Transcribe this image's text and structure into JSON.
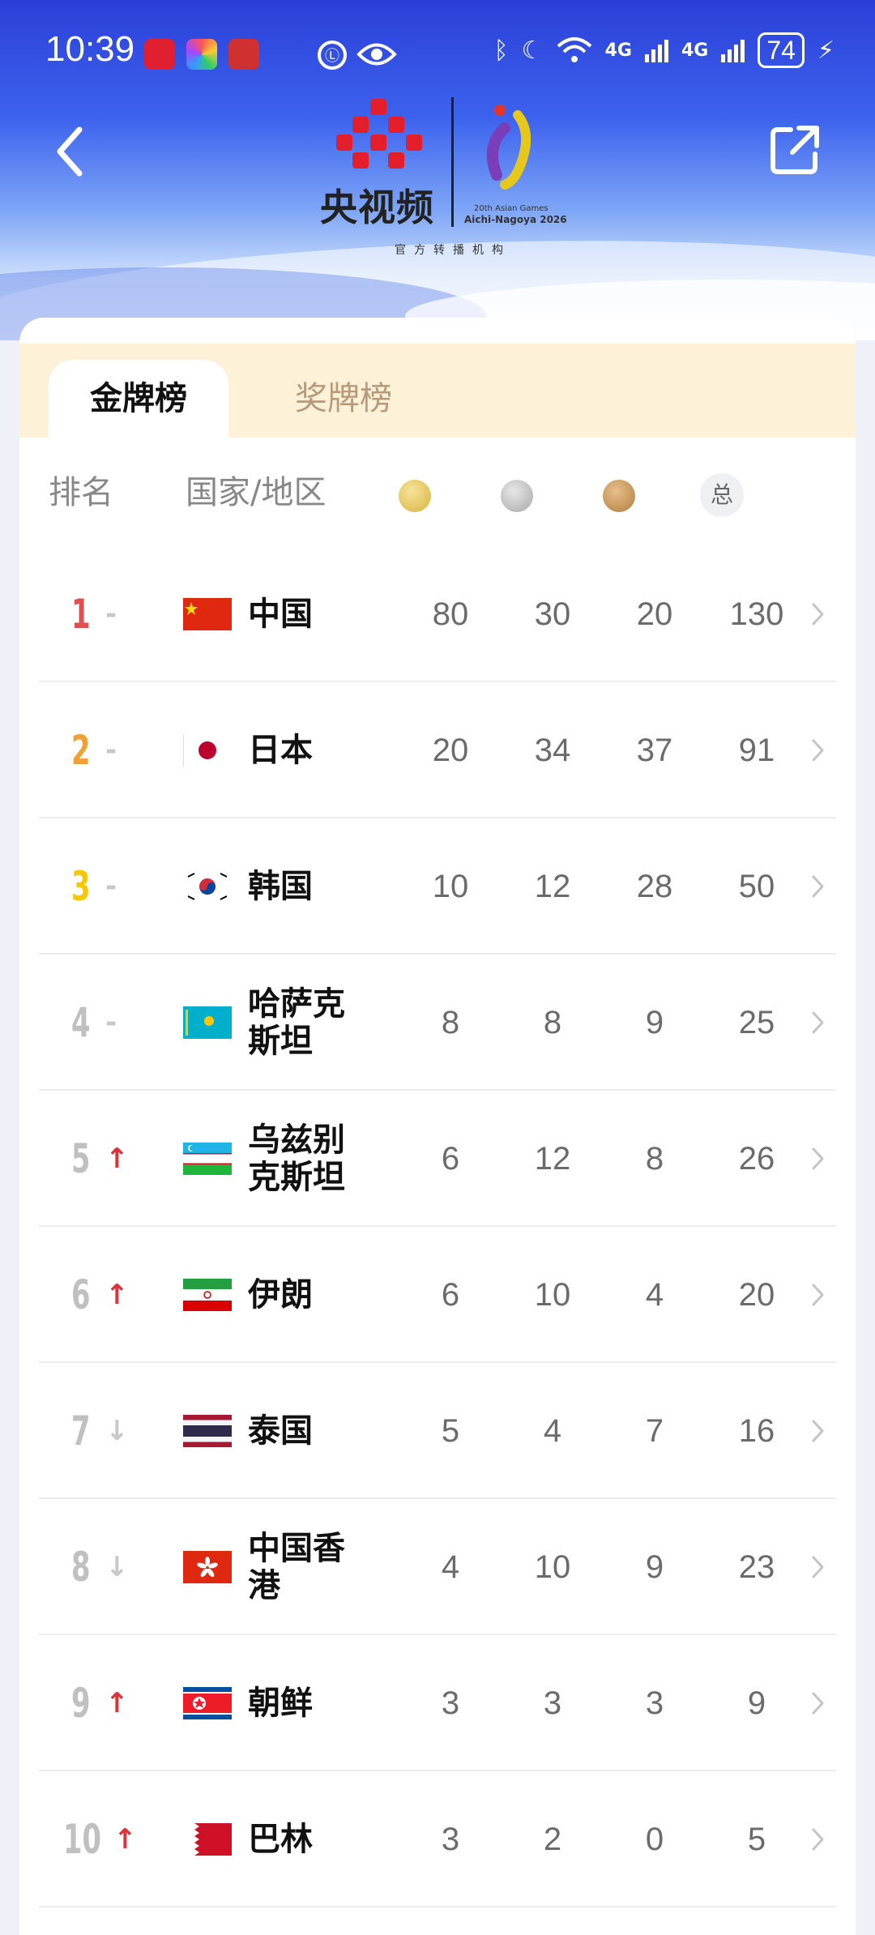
{
  "status_bar": {
    "time": "10:39",
    "battery": "74",
    "network": "4G"
  },
  "logo": {
    "brand": "央视频",
    "subtitle": "官方转播机构",
    "games_line1": "20th Asian Games",
    "games_line2": "Aichi-Nagoya 2026"
  },
  "tabs": [
    {
      "label": "金牌榜",
      "active": true
    },
    {
      "label": "奖牌榜",
      "active": false
    }
  ],
  "table": {
    "header": {
      "rank": "排名",
      "country": "国家/地区",
      "total": "总"
    },
    "rows": [
      {
        "rank": "1",
        "rank_color": "#e05050",
        "trend": "-",
        "trend_icon": "dash",
        "country": "中国",
        "flag": "china-flag",
        "gold": "80",
        "silver": "30",
        "bronze": "20",
        "total": "130"
      },
      {
        "rank": "2",
        "rank_color": "#f2a030",
        "trend": "-",
        "trend_icon": "dash",
        "country": "日本",
        "flag": "japan-flag",
        "gold": "20",
        "silver": "34",
        "bronze": "37",
        "total": "91"
      },
      {
        "rank": "3",
        "rank_color": "#f5c800",
        "trend": "-",
        "trend_icon": "dash",
        "country": "韩国",
        "flag": "korea-flag",
        "gold": "10",
        "silver": "12",
        "bronze": "28",
        "total": "50"
      },
      {
        "rank": "4",
        "rank_color": "#c0c0c0",
        "trend": "-",
        "trend_icon": "dash",
        "country": "哈萨克斯坦",
        "flag": "kazakhstan-flag",
        "gold": "8",
        "silver": "8",
        "bronze": "9",
        "total": "25"
      },
      {
        "rank": "5",
        "rank_color": "#c0c0c0",
        "trend": "↑",
        "trend_icon": "up-arrow",
        "country": "乌兹别克斯坦",
        "flag": "uzbekistan-flag",
        "gold": "6",
        "silver": "12",
        "bronze": "8",
        "total": "26"
      },
      {
        "rank": "6",
        "rank_color": "#c0c0c0",
        "trend": "↑",
        "trend_icon": "up-arrow",
        "country": "伊朗",
        "flag": "iran-flag",
        "gold": "6",
        "silver": "10",
        "bronze": "4",
        "total": "20"
      },
      {
        "rank": "7",
        "rank_color": "#c0c0c0",
        "trend": "↓",
        "trend_icon": "down-arrow",
        "country": "泰国",
        "flag": "thailand-flag",
        "gold": "5",
        "silver": "4",
        "bronze": "7",
        "total": "16"
      },
      {
        "rank": "8",
        "rank_color": "#c0c0c0",
        "trend": "↓",
        "trend_icon": "down-arrow",
        "country": "中国香港",
        "flag": "hongkong-flag",
        "gold": "4",
        "silver": "10",
        "bronze": "9",
        "total": "23"
      },
      {
        "rank": "9",
        "rank_color": "#c0c0c0",
        "trend": "↑",
        "trend_icon": "up-arrow",
        "country": "朝鲜",
        "flag": "dprk-flag",
        "gold": "3",
        "silver": "3",
        "bronze": "3",
        "total": "9"
      },
      {
        "rank": "10",
        "rank_color": "#c0c0c0",
        "trend": "↑",
        "trend_icon": "up-arrow",
        "country": "巴林",
        "flag": "bahrain-flag",
        "gold": "3",
        "silver": "2",
        "bronze": "0",
        "total": "5"
      }
    ]
  },
  "colors": {
    "accent_up": "#e0303a",
    "muted_down": "#c8c8c8",
    "gold_medal": "#e0c25a",
    "silver_medal": "#b9b9b9",
    "bronze_medal": "#c99a5c"
  }
}
